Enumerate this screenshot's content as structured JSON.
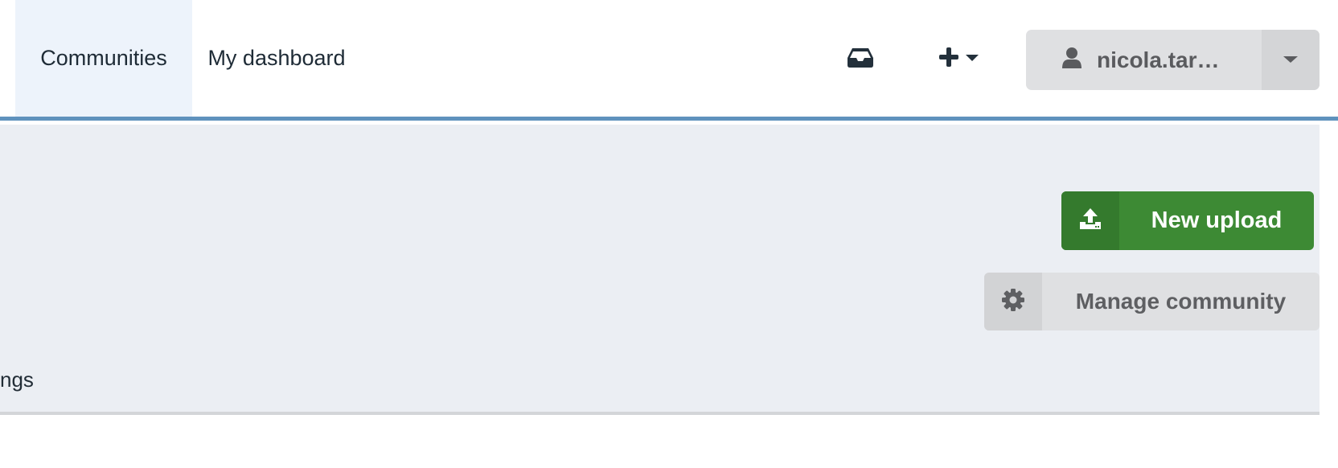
{
  "nav": {
    "items": [
      {
        "label": "Communities",
        "active": true
      },
      {
        "label": "My dashboard",
        "active": false
      }
    ],
    "inbox_icon": "inbox-icon",
    "plus_icon": "plus-icon",
    "user": {
      "name": "nicola.tar…",
      "icon": "user-icon",
      "caret_icon": "caret-down-icon"
    }
  },
  "header": {
    "new_upload": {
      "label": "New upload",
      "icon": "upload-icon"
    },
    "manage": {
      "label": "Manage community",
      "icon": "gear-icon"
    },
    "tab_partial": {
      "label": "ngs"
    }
  },
  "colors": {
    "accent_border": "#5f92bd",
    "header_bg": "#ebeef3",
    "nav_active_bg": "#edf3fb",
    "upload_green": "#3d8a34",
    "button_gray": "#dfe0e2"
  }
}
